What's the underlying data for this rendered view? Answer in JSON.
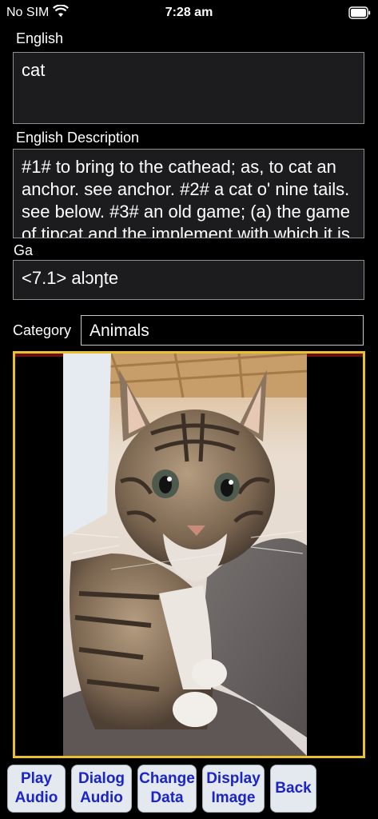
{
  "status": {
    "carrier": "No SIM",
    "time": "7:28 am"
  },
  "english": {
    "label": "English",
    "value": "cat"
  },
  "description": {
    "label": "English Description",
    "value": "#1# to bring to the cathead; as, to cat an anchor. see anchor. #2# a cat o' nine tails. see below. #3# an old game; (a) the game of tipcat and the implement with which it is played. see"
  },
  "ga": {
    "label": "Ga",
    "value": "<7.1> alɔŋte"
  },
  "category": {
    "label": "Category",
    "value": "Animals"
  },
  "image": {
    "subject": "tabby kitten photo"
  },
  "buttons": {
    "play_audio": "Play\nAudio",
    "dialog_audio": "Dialog\nAudio",
    "change_data": "Change\nData",
    "display_image": "Display\nImage",
    "back": "Back"
  },
  "colors": {
    "accent": "#1a24c8",
    "frame": "#e8c030",
    "field_bg": "#1c1c1e"
  }
}
